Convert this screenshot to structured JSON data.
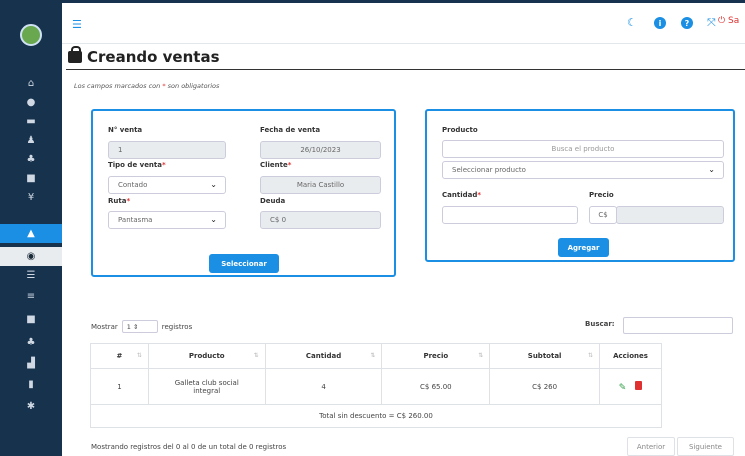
{
  "topbar": {
    "logout_label": "Sa"
  },
  "page": {
    "title": "Creando ventas",
    "required_note_prefix": "Los campos marcados con ",
    "required_note_star": "*",
    "required_note_suffix": " son obligatorios"
  },
  "sale_form": {
    "numero_label": "N° venta",
    "numero_value": "1",
    "fecha_label": "Fecha de venta",
    "fecha_value": "26/10/2023",
    "tipo_label": "Tipo de venta",
    "tipo_value": "Contado",
    "cliente_label": "Cliente",
    "cliente_value": "Maria Castillo",
    "ruta_label": "Ruta",
    "ruta_value": "Pantasma",
    "deuda_label": "Deuda",
    "deuda_value": "C$ 0",
    "select_button": "Seleccionar",
    "required_star": "*"
  },
  "product_form": {
    "producto_label": "Producto",
    "search_placeholder": "Busca el producto",
    "select_placeholder": "Seleccionar producto",
    "cantidad_label": "Cantidad",
    "precio_label": "Precio",
    "currency": "C$",
    "add_button": "Agregar",
    "required_star": "*"
  },
  "table_controls": {
    "show_label": "Mostrar",
    "show_value": "1",
    "records_label": "registros",
    "search_label": "Buscar:"
  },
  "table": {
    "columns": [
      "#",
      "Producto",
      "Cantidad",
      "Precio",
      "Subtotal",
      "Acciones"
    ],
    "rows": [
      {
        "num": "1",
        "producto_line1": "Galleta club social",
        "producto_line2": "integral",
        "cantidad": "4",
        "precio": "C$ 65.00",
        "subtotal": "C$ 260"
      }
    ],
    "total_text": "Total sin descuento = C$ 260.00"
  },
  "footer": {
    "showing_text": "Mostrando registros del 0 al 0 de un total de 0 registros",
    "prev_label": "Anterior",
    "next_label": "Siguiente"
  },
  "colors": {
    "sidebar": "#17324d",
    "accent": "#1a8fe3",
    "required": "#e03131"
  }
}
